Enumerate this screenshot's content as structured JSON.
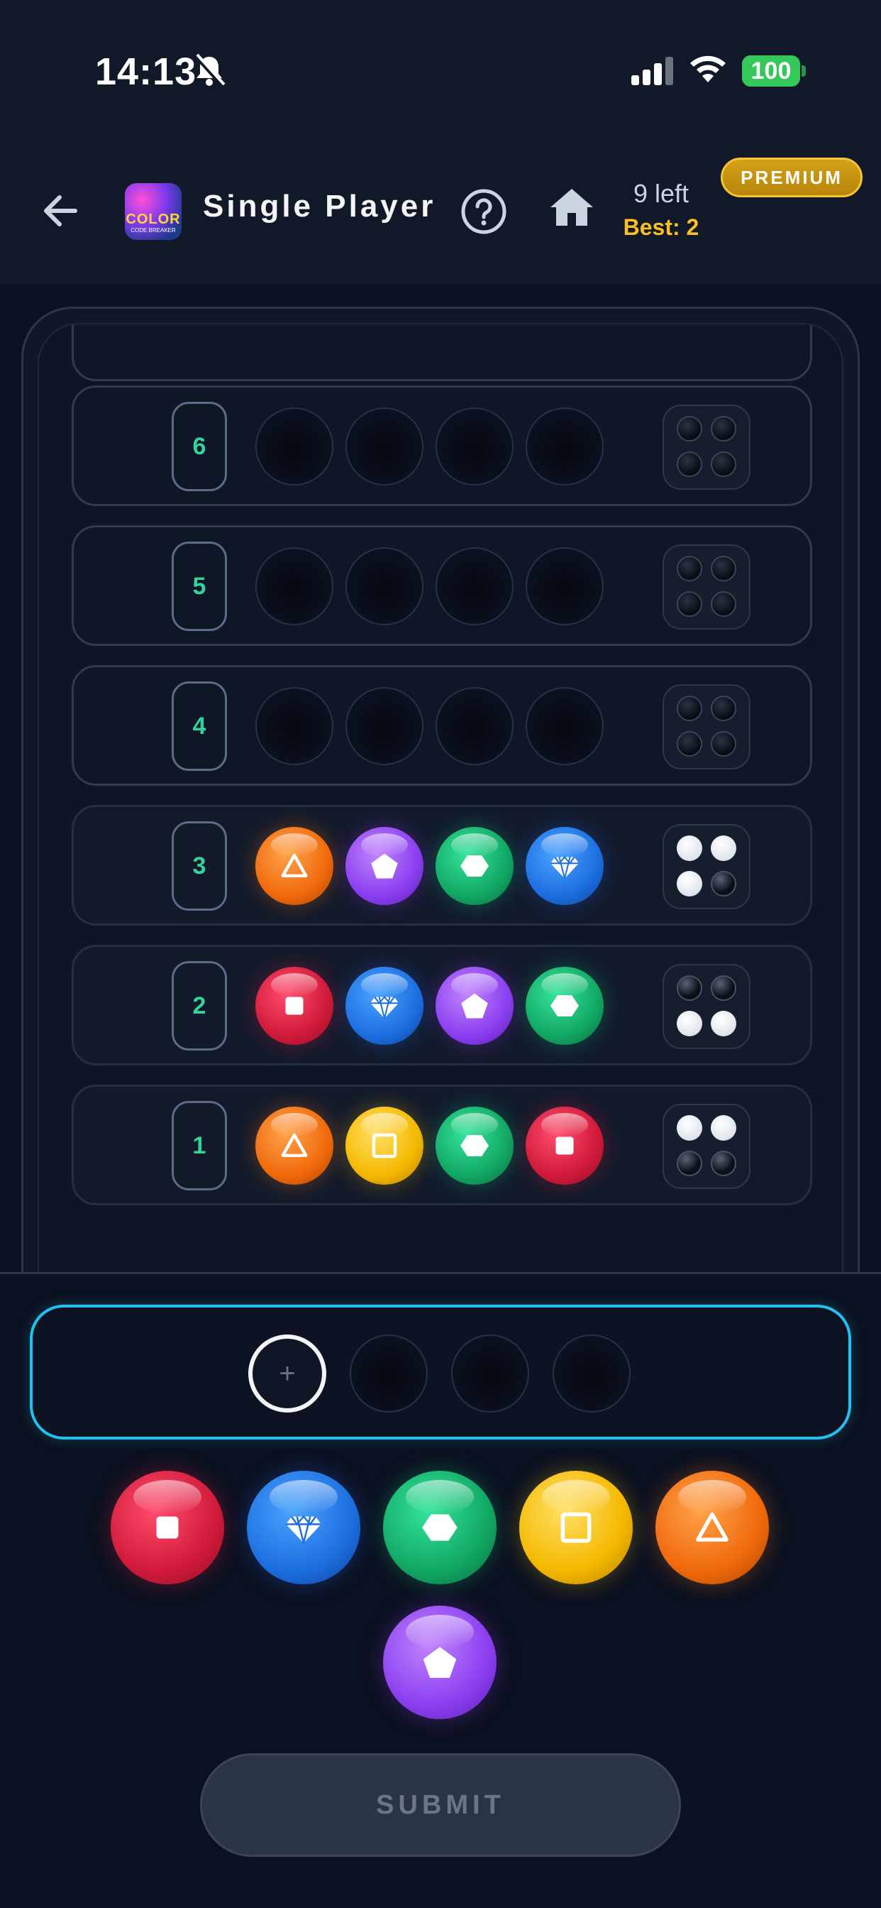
{
  "status_bar": {
    "time": "14:13",
    "battery": "100"
  },
  "header": {
    "logo_text": "COLOR",
    "logo_subtext": "CODE BREAKER",
    "title": "Single Player",
    "left_count": "9 left",
    "best": "Best: 2",
    "premium": "PREMIUM"
  },
  "colors": {
    "red": "#d11a3a",
    "blue": "#1d6fe0",
    "green": "#12a864",
    "yellow": "#f5b800",
    "orange": "#f06a0c",
    "purple": "#8b3ff0",
    "accent": "#22c1ee",
    "row_number": "#34d399",
    "best": "#fbbf24"
  },
  "rows": [
    {
      "number": "6",
      "pegs": [
        null,
        null,
        null,
        null
      ],
      "feedback": [
        "none",
        "none",
        "none",
        "none"
      ]
    },
    {
      "number": "5",
      "pegs": [
        null,
        null,
        null,
        null
      ],
      "feedback": [
        "none",
        "none",
        "none",
        "none"
      ]
    },
    {
      "number": "4",
      "pegs": [
        null,
        null,
        null,
        null
      ],
      "feedback": [
        "none",
        "none",
        "none",
        "none"
      ]
    },
    {
      "number": "3",
      "pegs": [
        "orange-triangle",
        "purple-pentagon",
        "green-hexagon",
        "blue-diamond"
      ],
      "feedback": [
        "white",
        "white",
        "white",
        "black"
      ]
    },
    {
      "number": "2",
      "pegs": [
        "red-square",
        "blue-diamond",
        "purple-pentagon",
        "green-hexagon"
      ],
      "feedback": [
        "black",
        "black",
        "white",
        "white"
      ]
    },
    {
      "number": "1",
      "pegs": [
        "orange-triangle",
        "yellow-square-outline",
        "green-hexagon",
        "red-square"
      ],
      "feedback": [
        "white",
        "white",
        "black",
        "black"
      ]
    }
  ],
  "current_guess": {
    "add_symbol": "+"
  },
  "palette": [
    {
      "color": "red",
      "icon": "square-icon"
    },
    {
      "color": "blue",
      "icon": "diamond-icon"
    },
    {
      "color": "green",
      "icon": "hexagon-icon"
    },
    {
      "color": "yellow",
      "icon": "square-outline-icon"
    },
    {
      "color": "orange",
      "icon": "triangle-icon"
    },
    {
      "color": "purple",
      "icon": "pentagon-icon"
    }
  ],
  "submit_label": "SUBMIT"
}
